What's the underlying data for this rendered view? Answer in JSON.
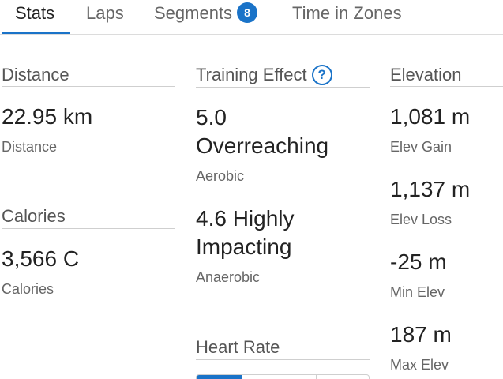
{
  "tabs": [
    {
      "label": "Stats",
      "active": true
    },
    {
      "label": "Laps",
      "active": false
    },
    {
      "label": "Segments",
      "badge": "8",
      "active": false
    },
    {
      "label": "Time in Zones",
      "active": false
    }
  ],
  "distance": {
    "title": "Distance",
    "value": "22.95 km",
    "label": "Distance"
  },
  "calories": {
    "title": "Calories",
    "value": "3,566 C",
    "label": "Calories"
  },
  "training_effect": {
    "title": "Training Effect",
    "aerobic_value_line1": "5.0",
    "aerobic_value_line2": "Overreaching",
    "aerobic_label": "Aerobic",
    "anaerobic_value_line1": "4.6 Highly",
    "anaerobic_value_line2": "Impacting",
    "anaerobic_label": "Anaerobic"
  },
  "heart_rate": {
    "title": "Heart Rate"
  },
  "elevation": {
    "title": "Elevation",
    "items": [
      {
        "value": "1,081 m",
        "label": "Elev Gain"
      },
      {
        "value": "1,137 m",
        "label": "Elev Loss"
      },
      {
        "value": "-25 m",
        "label": "Min Elev"
      },
      {
        "value": "187 m",
        "label": "Max Elev"
      }
    ]
  },
  "colors": {
    "accent": "#1a73c8",
    "text": "#222222",
    "muted": "#666666",
    "divider": "#cfcfcf"
  }
}
